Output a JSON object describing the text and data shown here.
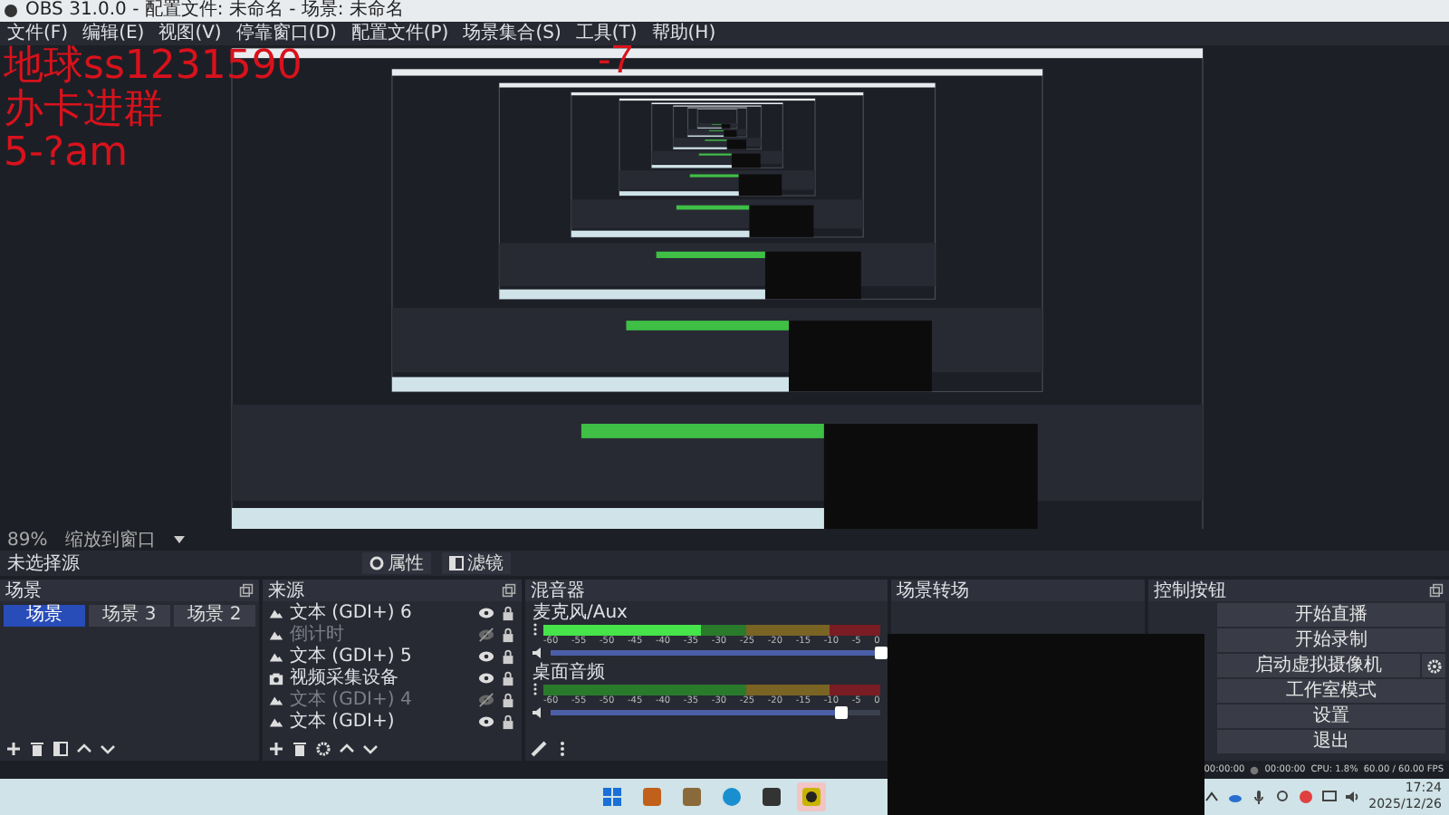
{
  "window": {
    "title": "OBS 31.0.0 - 配置文件: 未命名 - 场景: 未命名"
  },
  "menu": [
    "文件(F)",
    "编辑(E)",
    "视图(V)",
    "停靠窗口(D)",
    "配置文件(P)",
    "场景集合(S)",
    "工具(T)",
    "帮助(H)"
  ],
  "overlay": {
    "lines": [
      "地球ss1231590",
      "办卡进群",
      "5-?am"
    ],
    "mark": "-7"
  },
  "zoom": {
    "value": "89%",
    "mode": "缩放到窗口"
  },
  "source_toolbar": {
    "label": "未选择源",
    "buttons": [
      {
        "kind": "properties",
        "label": "属性"
      },
      {
        "kind": "filters",
        "label": "滤镜"
      }
    ]
  },
  "scenes": {
    "title": "场景",
    "items": [
      {
        "label": "场景",
        "selected": true
      },
      {
        "label": "场景 3",
        "selected": false
      },
      {
        "label": "场景 2",
        "selected": false
      }
    ]
  },
  "sources": {
    "title": "来源",
    "items": [
      {
        "label": "文本 (GDI+) 6",
        "kind": "text",
        "visible": true
      },
      {
        "label": "倒计时",
        "kind": "text",
        "visible": false
      },
      {
        "label": "文本 (GDI+) 5",
        "kind": "text",
        "visible": true
      },
      {
        "label": "视频采集设备",
        "kind": "camera",
        "visible": true
      },
      {
        "label": "文本 (GDI+) 4",
        "kind": "text",
        "visible": false
      },
      {
        "label": "文本 (GDI+)",
        "kind": "text",
        "visible": true
      }
    ]
  },
  "mixer": {
    "title": "混音器",
    "channels": [
      {
        "name": "麦克风/Aux",
        "level": 0.47,
        "scale": [
          "-60",
          "-55",
          "-50",
          "-45",
          "-40",
          "-35",
          "-30",
          "-25",
          "-20",
          "-15",
          "-10",
          "-5",
          "0"
        ],
        "fader": {
          "level": 1
        }
      },
      {
        "name": "桌面音频",
        "level": 0,
        "scale": [
          "-60",
          "-55",
          "-50",
          "-45",
          "-40",
          "-35",
          "-30",
          "-25",
          "-20",
          "-15",
          "-10",
          "-5",
          "0"
        ],
        "fader": {
          "level": 0.88
        }
      }
    ]
  },
  "transitions": {
    "title": "场景转场"
  },
  "controls": {
    "title": "控制按钮",
    "buttons": [
      {
        "label": "开始直播",
        "settings": false
      },
      {
        "label": "开始录制",
        "settings": false
      },
      {
        "label": "启动虚拟摄像机",
        "settings": true
      },
      {
        "label": "工作室模式",
        "settings": false
      },
      {
        "label": "设置",
        "settings": false
      },
      {
        "label": "退出",
        "settings": false
      }
    ]
  },
  "status": {
    "live": "00:00:00",
    "rec": "00:00:00",
    "cpu": "CPU: 1.8%",
    "fps": "60.00 / 60.00 FPS"
  },
  "taskbar": {
    "apps": [
      {
        "kind": "windows",
        "selected": false
      },
      {
        "kind": "app",
        "color": "#c0601a",
        "selected": false
      },
      {
        "kind": "app",
        "color": "#8a6a3a",
        "selected": false
      },
      {
        "kind": "browser",
        "color": "#1a8fd0",
        "selected": false
      },
      {
        "kind": "app",
        "color": "#333333",
        "selected": false
      },
      {
        "kind": "obs",
        "color": "#c8b400",
        "selected": true
      }
    ],
    "time": "17:24",
    "date": "2025/12/26"
  }
}
